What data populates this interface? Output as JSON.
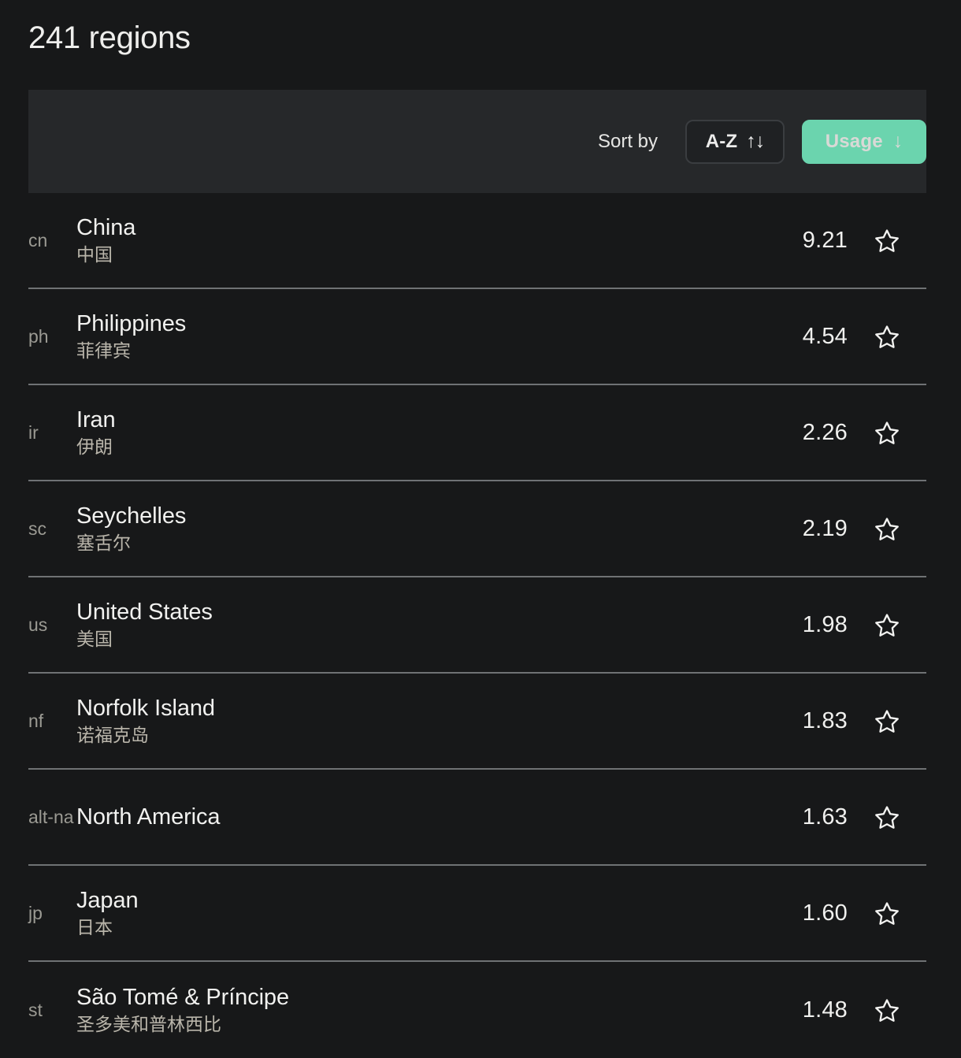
{
  "header": {
    "title": "241 regions"
  },
  "toolbar": {
    "sort_label": "Sort by",
    "sort_alpha_label": "A-Z",
    "sort_alpha_arrows": "↑↓",
    "sort_usage_label": "Usage",
    "sort_usage_arrow": "↓",
    "active_sort": "Usage",
    "accent_color": "#6bd4ae",
    "band_color": "#26282a"
  },
  "list": {
    "star_icon": "star-outline-icon",
    "rows": [
      {
        "code": "cn",
        "name": "China",
        "local": "中国",
        "value": "9.21",
        "starred": false
      },
      {
        "code": "ph",
        "name": "Philippines",
        "local": "菲律宾",
        "value": "4.54",
        "starred": false
      },
      {
        "code": "ir",
        "name": "Iran",
        "local": "伊朗",
        "value": "2.26",
        "starred": false
      },
      {
        "code": "sc",
        "name": "Seychelles",
        "local": "塞舌尔",
        "value": "2.19",
        "starred": false
      },
      {
        "code": "us",
        "name": "United States",
        "local": "美国",
        "value": "1.98",
        "starred": false
      },
      {
        "code": "nf",
        "name": "Norfolk Island",
        "local": "诺福克岛",
        "value": "1.83",
        "starred": false
      },
      {
        "code": "alt-na",
        "name": "North America",
        "local": "",
        "value": "1.63",
        "starred": false
      },
      {
        "code": "jp",
        "name": "Japan",
        "local": "日本",
        "value": "1.60",
        "starred": false
      },
      {
        "code": "st",
        "name": "São Tomé & Príncipe",
        "local": "圣多美和普林西比",
        "value": "1.48",
        "starred": false
      }
    ]
  }
}
